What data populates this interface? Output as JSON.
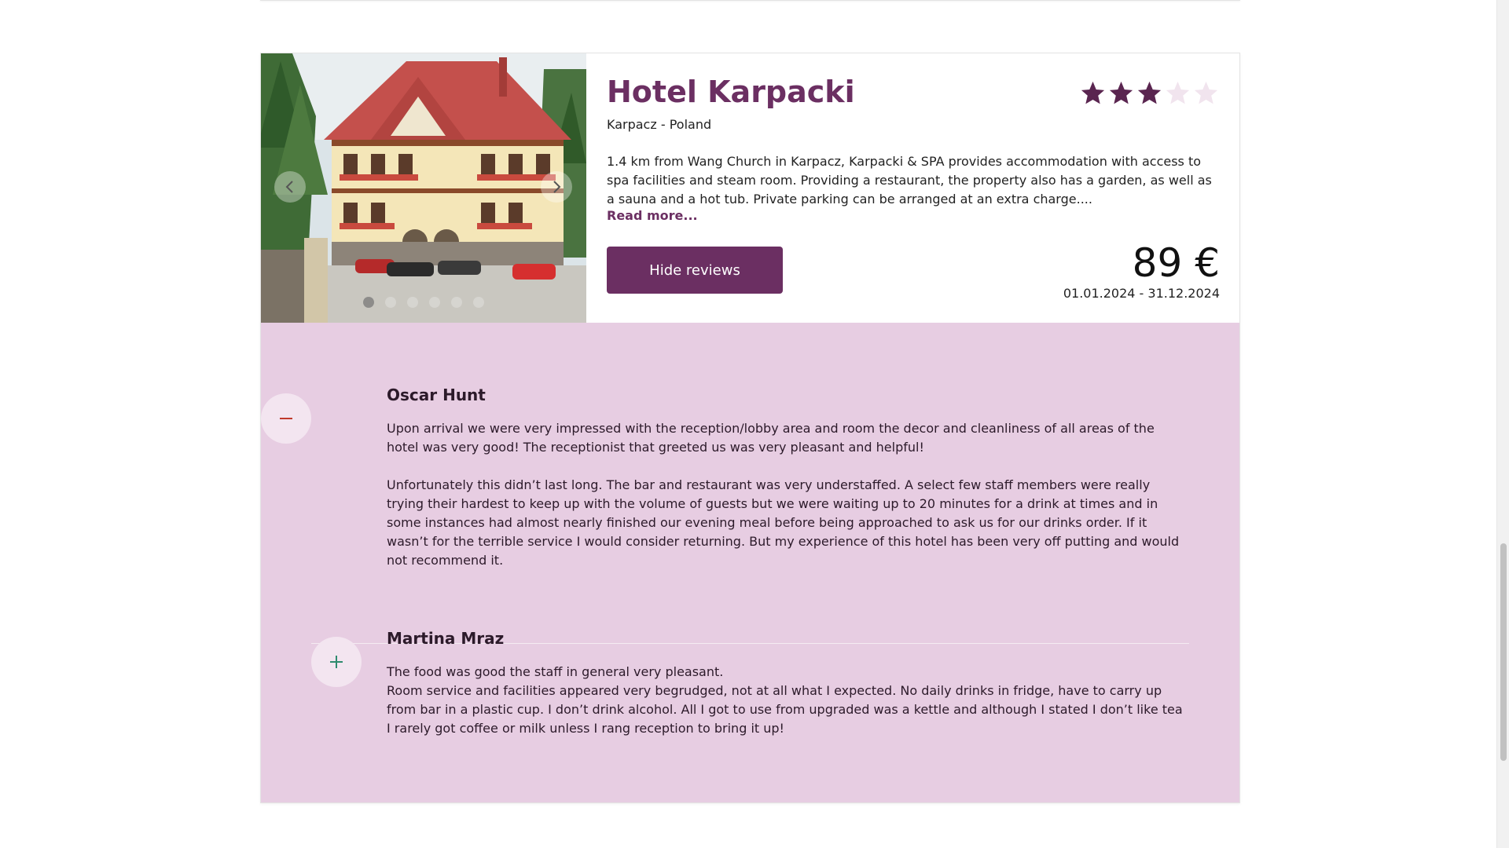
{
  "hotel": {
    "name": "Hotel Karpacki",
    "location": "Karpacz - Poland",
    "description": "1.4 km from Wang Church in Karpacz, Karpacki & SPA provides accommodation with access to spa facilities and steam room. Providing a restaurant, the property also has a garden, as well as a sauna and a hot tub. Private parking can be arranged at an extra charge....",
    "read_more_label": "Read more...",
    "stars": {
      "rating": 3,
      "max": 5,
      "filled_color": "#5a2550",
      "empty_color": "#f1e4ee"
    },
    "hide_reviews_label": "Hide reviews",
    "price": "89 €",
    "dates": "01.01.2024 - 31.12.2024",
    "gallery": {
      "prev_icon": "chevron-left-icon",
      "next_icon": "chevron-right-icon",
      "slide_count": 6,
      "active_slide": 1
    }
  },
  "reviews": [
    {
      "author": "Oscar Hunt",
      "expanded": true,
      "toggle_icon": "minus-icon",
      "paragraphs": [
        "Upon arrival we were very impressed with the reception/lobby area and room the decor and cleanliness of all areas of the hotel was very good! The receptionist that greeted us was very pleasant and helpful!",
        "Unfortunately this didn’t last long. The bar and restaurant was very understaffed. A select few staff members were really trying their hardest to keep up with the volume of guests but we were waiting up to 20 minutes for a drink at times and in some instances had almost nearly finished our evening meal before being approached to ask us for our drinks order. If it wasn’t for the terrible service I would consider returning. But my experience of this hotel has been very off putting and would not recommend it."
      ]
    },
    {
      "author": "Martina Mraz",
      "expanded": false,
      "toggle_icon": "plus-icon",
      "paragraphs": [
        "The food was good the staff in general very pleasant.",
        "Room service and facilities appeared very begrudged, not at all what I expected. No daily drinks in fridge, have to carry up from bar in a plastic cup. I don’t drink alcohol. All I got to use from upgraded was a kettle and although I stated I don’t like tea I rarely got coffee or milk unless I rang reception to bring it up!"
      ]
    }
  ],
  "colors": {
    "brand": "#6b2f62",
    "reviews_background": "#e7cde2",
    "minus_icon": "#c0392b",
    "plus_icon": "#2e8b6e"
  }
}
